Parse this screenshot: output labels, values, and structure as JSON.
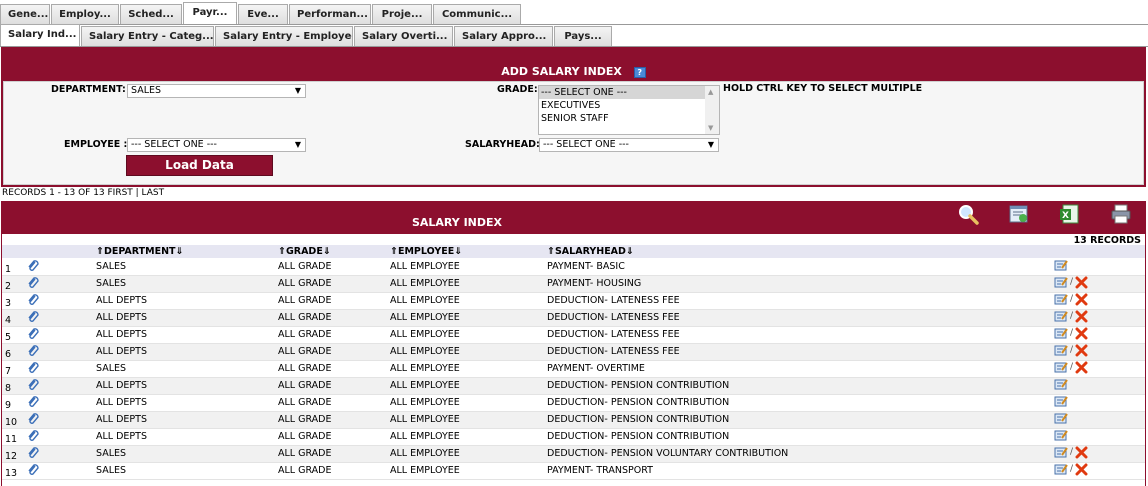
{
  "tabs_main": [
    {
      "label": "Gene..."
    },
    {
      "label": "Employ..."
    },
    {
      "label": "Sched..."
    },
    {
      "label": "Payr...",
      "active": true
    },
    {
      "label": "Eve..."
    },
    {
      "label": "Performan..."
    },
    {
      "label": "Proje..."
    },
    {
      "label": "Communic..."
    }
  ],
  "tabs_sub": [
    {
      "label": "Salary Ind...",
      "active": true
    },
    {
      "label": "Salary Entry - Categ..."
    },
    {
      "label": "Salary Entry - Employee"
    },
    {
      "label": "Salary Overti..."
    },
    {
      "label": "Salary Appro..."
    },
    {
      "label": "Pays..."
    }
  ],
  "form": {
    "title": "ADD SALARY INDEX",
    "help_icon": "?",
    "department_label": "DEPARTMENT:",
    "department_value": "SALES",
    "grade_label": "GRADE:",
    "grade_options": [
      "--- SELECT ONE ---",
      "EXECUTIVES",
      "SENIOR STAFF"
    ],
    "grade_hint": "HOLD CTRL KEY TO SELECT MULTIPLE",
    "employee_label": "EMPLOYEE :",
    "employee_value": "--- SELECT ONE ---",
    "salaryhead_label": "SALARYHEAD:",
    "salaryhead_value": "--- SELECT ONE ---",
    "load_button": "Load Data"
  },
  "records_line": "RECORDS 1 - 13 OF 13 FIRST | LAST",
  "results": {
    "title": "SALARY INDEX",
    "count_label": "13 RECORDS",
    "columns": {
      "department": "DEPARTMENT",
      "grade": "GRADE",
      "employee": "EMPLOYEE",
      "salaryhead": "SALARYHEAD"
    },
    "rows": [
      {
        "n": "1",
        "department": "SALES",
        "grade": "ALL GRADE",
        "employee": "ALL EMPLOYEE",
        "salaryhead": "PAYMENT- BASIC",
        "deletable": false
      },
      {
        "n": "2",
        "department": "SALES",
        "grade": "ALL GRADE",
        "employee": "ALL EMPLOYEE",
        "salaryhead": "PAYMENT- HOUSING",
        "deletable": true
      },
      {
        "n": "3",
        "department": "ALL DEPTS",
        "grade": "ALL GRADE",
        "employee": "ALL EMPLOYEE",
        "salaryhead": "DEDUCTION- LATENESS FEE",
        "deletable": true
      },
      {
        "n": "4",
        "department": "ALL DEPTS",
        "grade": "ALL GRADE",
        "employee": "ALL EMPLOYEE",
        "salaryhead": "DEDUCTION- LATENESS FEE",
        "deletable": true
      },
      {
        "n": "5",
        "department": "ALL DEPTS",
        "grade": "ALL GRADE",
        "employee": "ALL EMPLOYEE",
        "salaryhead": "DEDUCTION- LATENESS FEE",
        "deletable": true
      },
      {
        "n": "6",
        "department": "ALL DEPTS",
        "grade": "ALL GRADE",
        "employee": "ALL EMPLOYEE",
        "salaryhead": "DEDUCTION- LATENESS FEE",
        "deletable": true
      },
      {
        "n": "7",
        "department": "SALES",
        "grade": "ALL GRADE",
        "employee": "ALL EMPLOYEE",
        "salaryhead": "PAYMENT- OVERTIME",
        "deletable": true
      },
      {
        "n": "8",
        "department": "ALL DEPTS",
        "grade": "ALL GRADE",
        "employee": "ALL EMPLOYEE",
        "salaryhead": "DEDUCTION- PENSION CONTRIBUTION",
        "deletable": false
      },
      {
        "n": "9",
        "department": "ALL DEPTS",
        "grade": "ALL GRADE",
        "employee": "ALL EMPLOYEE",
        "salaryhead": "DEDUCTION- PENSION CONTRIBUTION",
        "deletable": false
      },
      {
        "n": "10",
        "department": "ALL DEPTS",
        "grade": "ALL GRADE",
        "employee": "ALL EMPLOYEE",
        "salaryhead": "DEDUCTION- PENSION CONTRIBUTION",
        "deletable": false
      },
      {
        "n": "11",
        "department": "ALL DEPTS",
        "grade": "ALL GRADE",
        "employee": "ALL EMPLOYEE",
        "salaryhead": "DEDUCTION- PENSION CONTRIBUTION",
        "deletable": false
      },
      {
        "n": "12",
        "department": "SALES",
        "grade": "ALL GRADE",
        "employee": "ALL EMPLOYEE",
        "salaryhead": "DEDUCTION- PENSION VOLUNTARY CONTRIBUTION",
        "deletable": true
      },
      {
        "n": "13",
        "department": "SALES",
        "grade": "ALL GRADE",
        "employee": "ALL EMPLOYEE",
        "salaryhead": "PAYMENT- TRANSPORT",
        "deletable": true
      }
    ]
  },
  "icons": {
    "search": "magnifier-icon",
    "report": "report-icon",
    "excel": "excel-icon",
    "print": "printer-icon",
    "attach": "paperclip-icon",
    "edit": "edit-icon",
    "delete": "delete-icon"
  },
  "colors": {
    "brand": "#8c0f2e",
    "header_row": "#e6e6f2",
    "alt_row": "#f1f1f1",
    "delete": "#e03a10",
    "link": "#3b6fb8"
  }
}
